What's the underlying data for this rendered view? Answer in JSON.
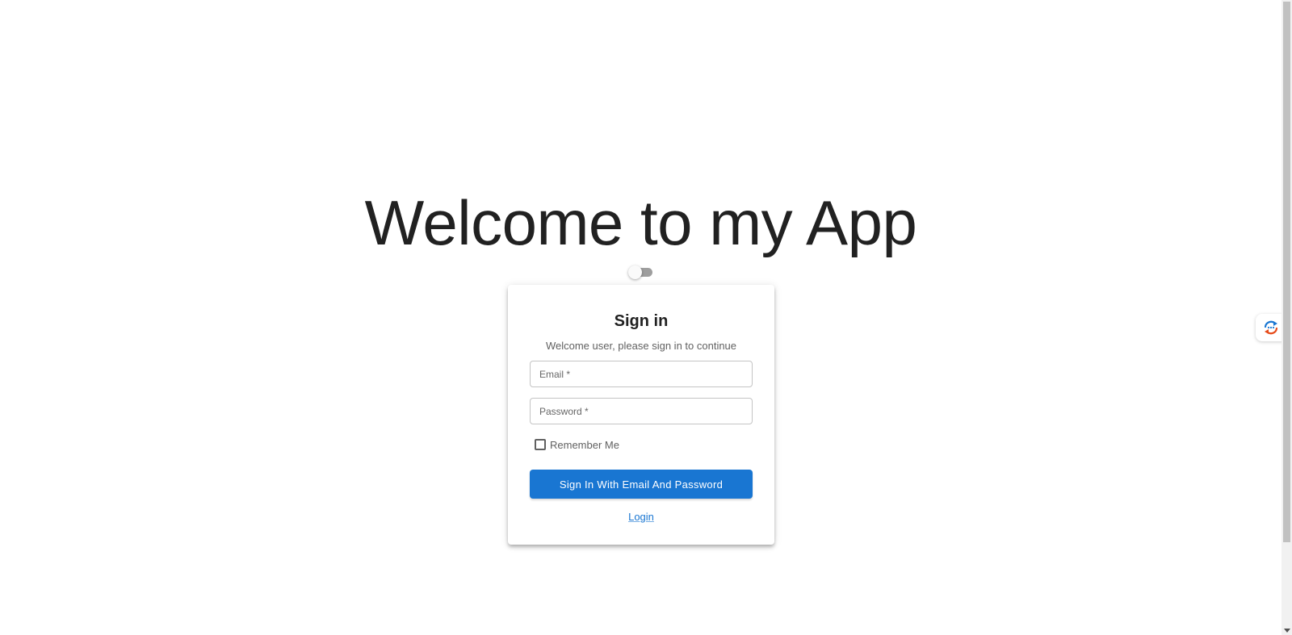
{
  "hero": {
    "title": "Welcome to my App"
  },
  "theme_toggle": {
    "checked": false
  },
  "signin": {
    "title": "Sign in",
    "subtitle": "Welcome user, please sign in to continue",
    "email_placeholder": "Email *",
    "password_placeholder": "Password *",
    "remember_label": "Remember Me",
    "button_label": "Sign In With Email And Password",
    "link_label": "Login"
  },
  "colors": {
    "primary": "#1976d2",
    "text": "#212121",
    "muted": "#616161"
  },
  "icons": {
    "side_widget": "refresh-chat-icon"
  }
}
